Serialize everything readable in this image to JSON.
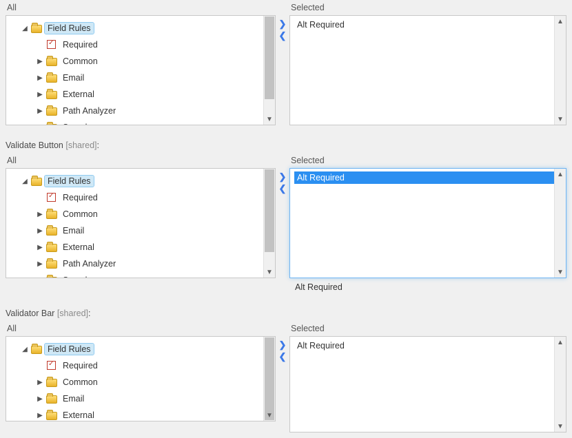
{
  "labels": {
    "all": "All",
    "selected": "Selected"
  },
  "sections": [
    {
      "id": "sec0",
      "title": null,
      "shared": false,
      "tree_root_label": "Field Rules",
      "tree_items": [
        "Required",
        "Common",
        "Email",
        "External",
        "Path Analyzer",
        "Sample"
      ],
      "tree_item_types": [
        "required",
        "folder",
        "folder",
        "folder",
        "folder",
        "folder"
      ],
      "selected_items": [
        "Alt Required"
      ],
      "list_highlight_index": -1,
      "show_caption": false,
      "caption": ""
    },
    {
      "id": "sec1",
      "title": "Validate Button",
      "shared": true,
      "tree_root_label": "Field Rules",
      "tree_items": [
        "Required",
        "Common",
        "Email",
        "External",
        "Path Analyzer",
        "Sample"
      ],
      "tree_item_types": [
        "required",
        "folder",
        "folder",
        "folder",
        "folder",
        "folder"
      ],
      "selected_items": [
        "Alt Required"
      ],
      "list_highlight_index": 0,
      "show_caption": true,
      "caption": "Alt Required"
    },
    {
      "id": "sec2",
      "title": "Validator Bar",
      "shared": true,
      "tree_root_label": "Field Rules",
      "tree_items": [
        "Required",
        "Common",
        "Email",
        "External"
      ],
      "tree_item_types": [
        "required",
        "folder",
        "folder",
        "folder"
      ],
      "selected_items": [
        "Alt Required"
      ],
      "list_highlight_index": -1,
      "show_caption": false,
      "caption": ""
    }
  ],
  "shared_suffix": "[shared]",
  "glyphs": {
    "expander_open": "◢",
    "expander_closed": "▶",
    "arrow_up": "▲",
    "arrow_down": "▼",
    "move_right": "❯",
    "move_left": "❮"
  }
}
